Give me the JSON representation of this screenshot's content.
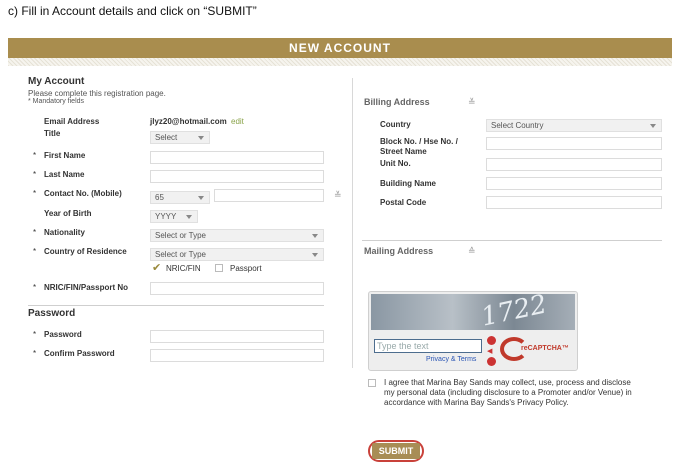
{
  "caption": "c) Fill in Account details and click on “SUBMIT”",
  "banner": {
    "title": "NEW ACCOUNT"
  },
  "account": {
    "heading": "My Account",
    "intro": "Please complete this registration page.",
    "mandatory": "* Mandatory fields",
    "email_label": "Email Address",
    "email_value": "jlyz20@hotmail.com",
    "email_edit": "edit",
    "title_label": "Title",
    "title_select": "Select",
    "first_name_label": "First Name",
    "last_name_label": "Last Name",
    "contact_label": "Contact No. (Mobile)",
    "contact_code": "65",
    "year_label": "Year of Birth",
    "year_select": "YYYY",
    "nationality_label": "Nationality",
    "nationality_select": "Select or Type",
    "residence_label": "Country of Residence",
    "residence_select": "Select or Type",
    "id_option_1": "NRIC/FIN",
    "id_option_2": "Passport",
    "nric_label": "NRIC/FIN/Passport No"
  },
  "password": {
    "heading": "Password",
    "password_label": "Password",
    "confirm_label": "Confirm Password"
  },
  "billing": {
    "heading": "Billing Address",
    "country_label": "Country",
    "country_select": "Select Country",
    "block_label": "Block No. / Hse No. / Street Name",
    "unit_label": "Unit No.",
    "building_label": "Building Name",
    "postal_label": "Postal Code"
  },
  "mailing": {
    "heading": "Mailing Address"
  },
  "captcha": {
    "word": "1722",
    "placeholder": "Type the text",
    "privacy": "Privacy & Terms",
    "brand": "reCAPTCHA™"
  },
  "agree_text": "I agree that Marina Bay Sands may collect, use, process and disclose my personal data (including disclosure to a Promoter and/or Venue) in accordance with Marina Bay Sands's Privacy Policy.",
  "submit_label": "SUBMIT",
  "colors": {
    "banner": "#a98d4e",
    "submit_ring": "#c9413a"
  }
}
